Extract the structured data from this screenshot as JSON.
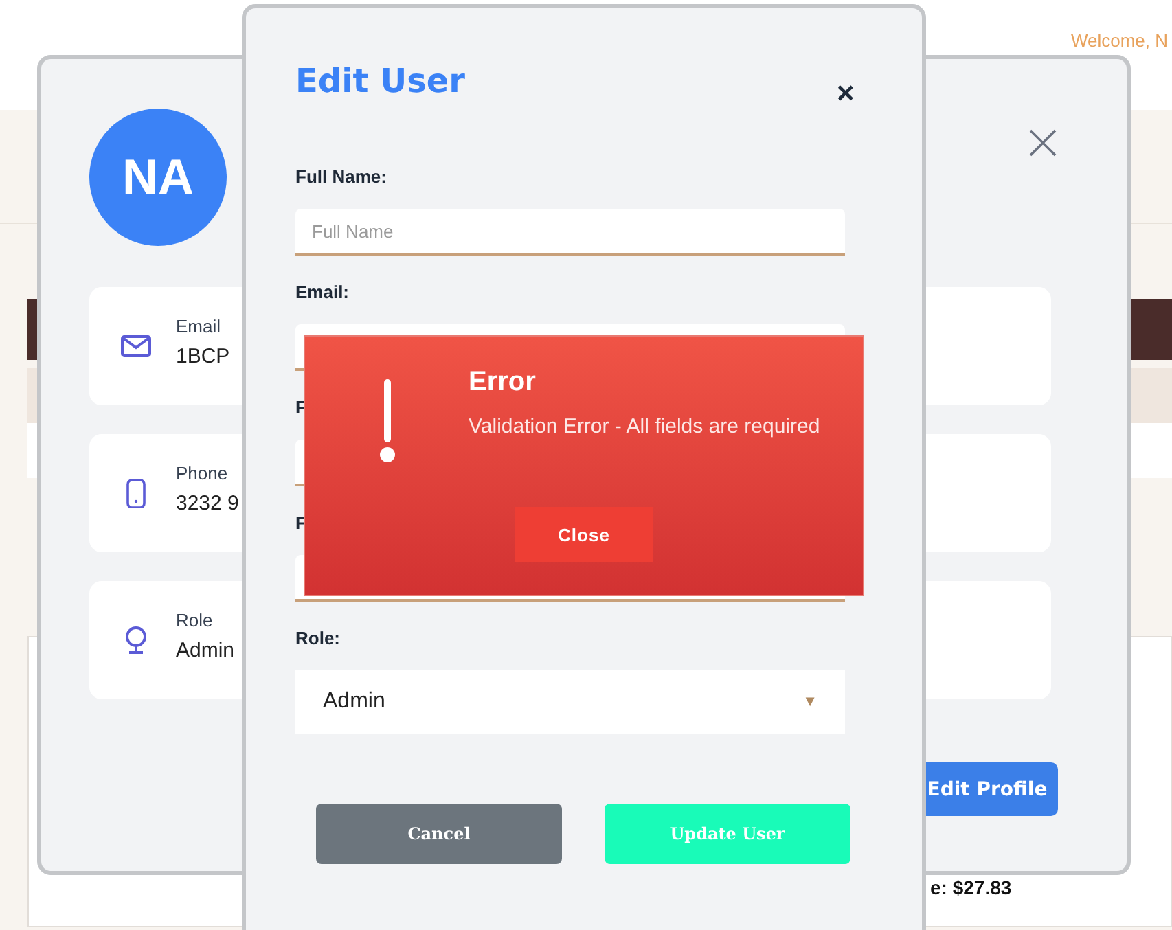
{
  "page": {
    "greeting": "Welcome, N",
    "total": "e: $27.83"
  },
  "profile": {
    "initials": "NA",
    "fields": [
      {
        "kind": "email",
        "label": "Email",
        "value": "1BCP"
      },
      {
        "kind": "phone",
        "label": "Phone",
        "value": "3232 9"
      },
      {
        "kind": "role",
        "label": "Role",
        "value": "Admin"
      }
    ],
    "edit_button": "Edit Profile"
  },
  "edit_user": {
    "title": "Edit User",
    "close": "×",
    "fields": [
      {
        "label": "Full Name:",
        "placeholder": "Full Name"
      },
      {
        "label": "Email:"
      },
      {
        "label": "F"
      },
      {
        "label": "F"
      }
    ],
    "role": {
      "label": "Role:",
      "value": "Admin",
      "caret": "▼"
    },
    "buttons": [
      {
        "kind": "secondary",
        "label": "Cancel"
      },
      {
        "kind": "primary",
        "label": "Update User"
      }
    ]
  },
  "error": {
    "title": "Error",
    "message": "Validation Error - All fields are required",
    "button": "Close"
  }
}
